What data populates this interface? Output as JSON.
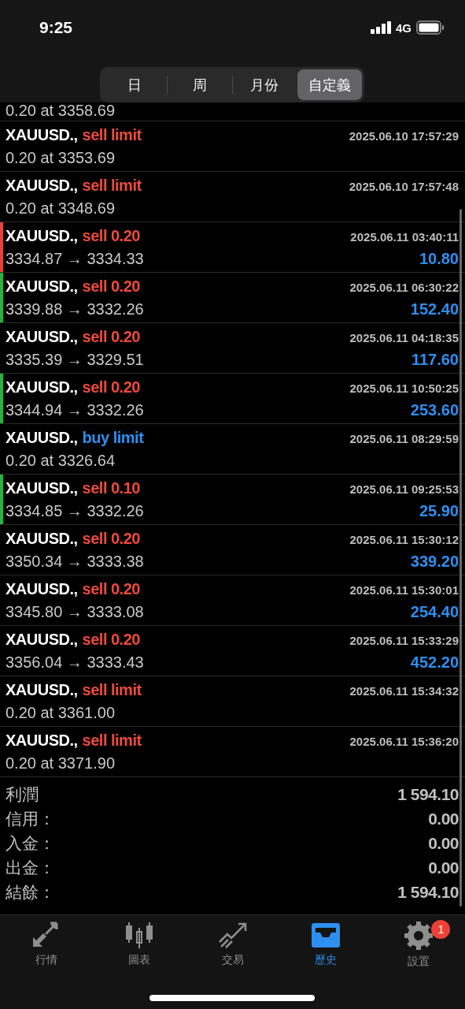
{
  "status_bar": {
    "time": "9:25",
    "network": "4G"
  },
  "period_tabs": [
    {
      "label": "日",
      "selected": false
    },
    {
      "label": "周",
      "selected": false
    },
    {
      "label": "月份",
      "selected": false
    },
    {
      "label": "自定義",
      "selected": true
    }
  ],
  "partial_row": {
    "detail": "0.20 at 3358.69"
  },
  "orders": [
    {
      "symbol": "XAUUSD.,",
      "action": "sell limit",
      "kind": "sell",
      "time": "2025.06.10 17:57:29",
      "detail": "0.20 at 3353.69"
    },
    {
      "symbol": "XAUUSD.,",
      "action": "sell limit",
      "kind": "sell",
      "time": "2025.06.10 17:57:48",
      "detail": "0.20 at 3348.69"
    },
    {
      "symbol": "XAUUSD.,",
      "action": "sell 0.20",
      "kind": "sell",
      "time": "2025.06.11 03:40:11",
      "detail": "3334.87 → 3334.33",
      "profit": "10.80",
      "color": "#e0443a"
    },
    {
      "symbol": "XAUUSD.,",
      "action": "sell 0.20",
      "kind": "sell",
      "time": "2025.06.11 06:30:22",
      "detail": "3339.88 → 3332.26",
      "profit": "152.40",
      "color": "#27b43e"
    },
    {
      "symbol": "XAUUSD.,",
      "action": "sell 0.20",
      "kind": "sell",
      "time": "2025.06.11 04:18:35",
      "detail": "3335.39 → 3329.51",
      "profit": "117.60"
    },
    {
      "symbol": "XAUUSD.,",
      "action": "sell 0.20",
      "kind": "sell",
      "time": "2025.06.11 10:50:25",
      "detail": "3344.94 → 3332.26",
      "profit": "253.60",
      "color": "#27b43e"
    },
    {
      "symbol": "XAUUSD.,",
      "action": "buy limit",
      "kind": "buy",
      "time": "2025.06.11 08:29:59",
      "detail": "0.20 at 3326.64"
    },
    {
      "symbol": "XAUUSD.,",
      "action": "sell 0.10",
      "kind": "sell",
      "time": "2025.06.11 09:25:53",
      "detail": "3334.85 → 3332.26",
      "profit": "25.90",
      "color": "#27b43e"
    },
    {
      "symbol": "XAUUSD.,",
      "action": "sell 0.20",
      "kind": "sell",
      "time": "2025.06.11 15:30:12",
      "detail": "3350.34 → 3333.38",
      "profit": "339.20"
    },
    {
      "symbol": "XAUUSD.,",
      "action": "sell 0.20",
      "kind": "sell",
      "time": "2025.06.11 15:30:01",
      "detail": "3345.80 → 3333.08",
      "profit": "254.40"
    },
    {
      "symbol": "XAUUSD.,",
      "action": "sell 0.20",
      "kind": "sell",
      "time": "2025.06.11 15:33:29",
      "detail": "3356.04 → 3333.43",
      "profit": "452.20"
    },
    {
      "symbol": "XAUUSD.,",
      "action": "sell limit",
      "kind": "sell",
      "time": "2025.06.11 15:34:32",
      "detail": "0.20 at 3361.00"
    },
    {
      "symbol": "XAUUSD.,",
      "action": "sell limit",
      "kind": "sell",
      "time": "2025.06.11 15:36:20",
      "detail": "0.20 at 3371.90"
    }
  ],
  "summary": [
    {
      "label": "利潤",
      "value": "1 594.10"
    },
    {
      "label": "信用：",
      "value": "0.00"
    },
    {
      "label": "入金：",
      "value": "0.00"
    },
    {
      "label": "出金：",
      "value": "0.00"
    },
    {
      "label": "結餘：",
      "value": "1 594.10"
    }
  ],
  "tab_bar": [
    {
      "label": "行情",
      "kind": "quotes",
      "selected": false
    },
    {
      "label": "圖表",
      "kind": "chart",
      "selected": false
    },
    {
      "label": "交易",
      "kind": "trade",
      "selected": false
    },
    {
      "label": "歷史",
      "kind": "history",
      "selected": true
    },
    {
      "label": "設置",
      "kind": "settings",
      "selected": false,
      "badge": "1"
    }
  ]
}
